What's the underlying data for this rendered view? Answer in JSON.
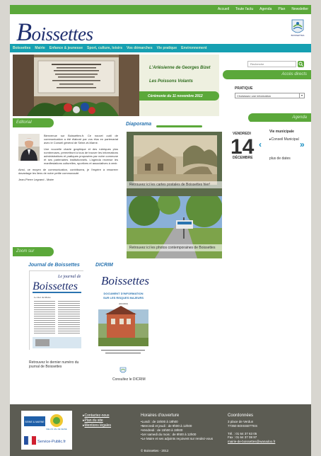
{
  "topnav": {
    "links": [
      "Accueil",
      "Toute l'actu",
      "Agenda",
      "Plan",
      "Newsletter"
    ]
  },
  "header": {
    "logo_initial": "B",
    "logo_rest": "oissettes",
    "crest_label": "BOISSETTES"
  },
  "mainnav": {
    "items": [
      "Boissettes",
      "Mairie",
      "Enfance & jeunesse",
      "Sport, culture, loisirs",
      "Vos démarches",
      "Vie pratique",
      "Environnement"
    ]
  },
  "hero": {
    "link1": "L'Arlésienne de Georges Bizet",
    "link2": "Les Poissons Volants",
    "tab": "Cérémonie du 11 novembre 2012"
  },
  "sidebar": {
    "search_placeholder": "Recherche",
    "acces_directs": "Accès directs",
    "pratique_label": "PRATIQUE",
    "select_value": "Choisissez une information",
    "agenda_tab": "Agenda",
    "agenda": {
      "city": "VENDREDI",
      "day": "14",
      "month": "DÉCEMBRE",
      "title": "Vie municipale",
      "event": "Conseil Municipal",
      "more": "plus de dates"
    }
  },
  "editorial": {
    "tab": "Editorial",
    "p1": "Bienvenue sur Boissettes.fr. Ce nouvel outil de communication a été élaboré par vos élus en partenariat avec le Conseil général de Seine-et-Marne.",
    "p2": "Une nouvelle charte graphique et des rubriques plus nombreuses, permettront à tous de trouver les informations administratives et pratiques proposées par notre commune et ses partenaires institutionnels. L'agenda recense les manifestations culturelles, sportives et associatives à venir.",
    "p3": "Ainsi, ce moyen de communication, contribuera, je l'espère à resserrer davantage les liens de notre petite communauté.",
    "signature": "Jean-Pierre Legrand - Maire"
  },
  "diaporama": {
    "title": "Diaporama",
    "caption1": "Retrouvez ici les cartes postales de Boissettes hier!",
    "caption2": "Retrouvez ici les photos contemporaines de Boissettes"
  },
  "zoom": {
    "tab": "Zoom sur",
    "journal_title": "Journal de Boissettes",
    "journal_cover_small": "Le journal de",
    "journal_cover_big": "Boissettes",
    "journal_cover_sub": "Le mot du Maire",
    "journal_caption": "Retrouvez le dernier numéro du journal de Boissettes",
    "dicrim_title": "DICRIM",
    "dicrim_cover_logo": "Boissettes",
    "dicrim_cover_heading": "DOCUMENT D'INFORMATION SUR LES RISQUES MAJEURS",
    "dicrim_cover_sub": "(DICRIM)",
    "dicrim_caption": "Consultez le DICRIM"
  },
  "footer": {
    "links": [
      "Contactez-nous",
      "Plan du site",
      "Mentions légales"
    ],
    "logo_seine": "SEINE & MARNE",
    "logo_melun": "MELUN VAL DE SEINE",
    "logo_sp": "Service-Public.fr",
    "hours_title": "Horaires d'ouverture",
    "hours": [
      "Lundi : de 15h00 à 18h00",
      "Mercredi et jeudi : de 9h00 à 12h00",
      "Vendredi : de 15h00 à 19h00",
      "1er samedi du mois : de 9h00 à 12h00",
      "Le Maire et ses adjoints reçoivent sur rendez-vous"
    ],
    "coords_title": "Coordonnées",
    "coords": [
      "3 place de Verdun",
      "77350 BOISSETTES",
      "",
      "Tél. : 01 64 37 63 05",
      "Fax : 01 64 37 08 97",
      "mairie-de-boissettes@wanadoo.fr"
    ],
    "copyright": "© Boissettes - 2012"
  }
}
